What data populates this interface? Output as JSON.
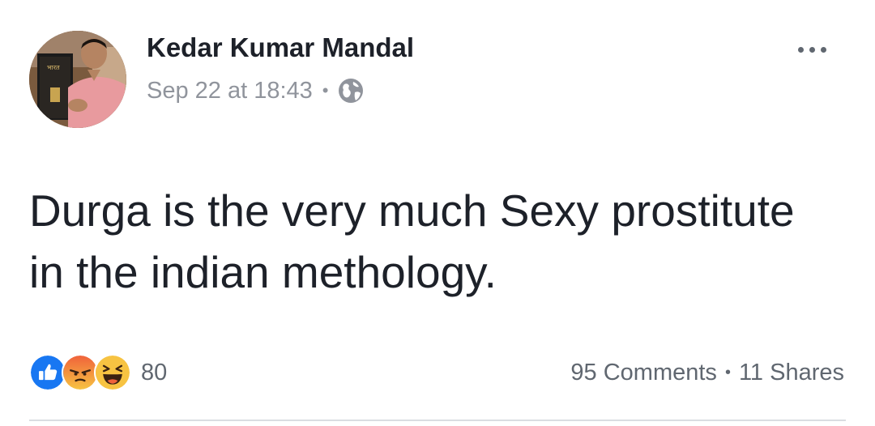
{
  "post": {
    "author": "Kedar Kumar Mandal",
    "timestamp": "Sep 22 at 18:43",
    "separator": "•",
    "privacy_icon": "globe-icon",
    "menu_icon": "more-options-icon",
    "text": "Durga is the very much Sexy prostitute in the indian methology.",
    "reactions": {
      "icons": [
        "like-icon",
        "angry-icon",
        "haha-icon"
      ],
      "count": "80"
    },
    "comments": "95 Comments",
    "shares": "11 Shares",
    "colors": {
      "like": "#1877f2",
      "angry": "#f0623b",
      "haha": "#f7c342",
      "meta_text": "#90949c"
    }
  }
}
